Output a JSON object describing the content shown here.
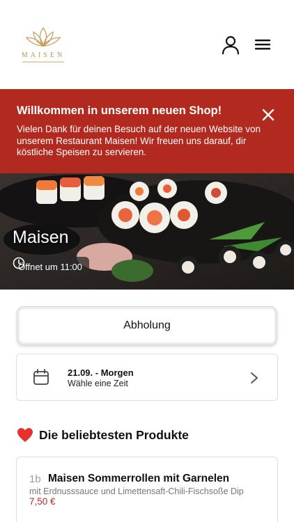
{
  "header": {
    "logo_text": "MAISEN"
  },
  "banner": {
    "title": "Willkommen in unserem neuen Shop!",
    "text": "Vielen Dank für deinen Besuch auf der neuen Website von unserem Restaurant Maisen! Wir freuen uns darauf, dir köstliche Speisen zu servieren."
  },
  "hero": {
    "restaurant_name": "Maisen",
    "hours": "Öffnet um 11:00"
  },
  "order": {
    "pickup_label": "Abholung",
    "date_main": "21.09. - Morgen",
    "date_sub": "Wähle eine Zeit"
  },
  "popular": {
    "title": "Die beliebtesten Produkte",
    "items": [
      {
        "number": "1b",
        "name": "Maisen Sommerrollen mit Garnelen",
        "description": "mit Erdnusssauce und Limettensaft-Chili-Fischsoße Dip",
        "price": "7,50 €"
      }
    ]
  },
  "colors": {
    "accent": "#b22a1f",
    "logo_gold": "#b8925a"
  },
  "icons": [
    "lotus-logo",
    "user-icon",
    "menu-icon",
    "close-icon",
    "clock-icon",
    "calendar-icon",
    "chevron-right-icon",
    "heart-icon"
  ]
}
